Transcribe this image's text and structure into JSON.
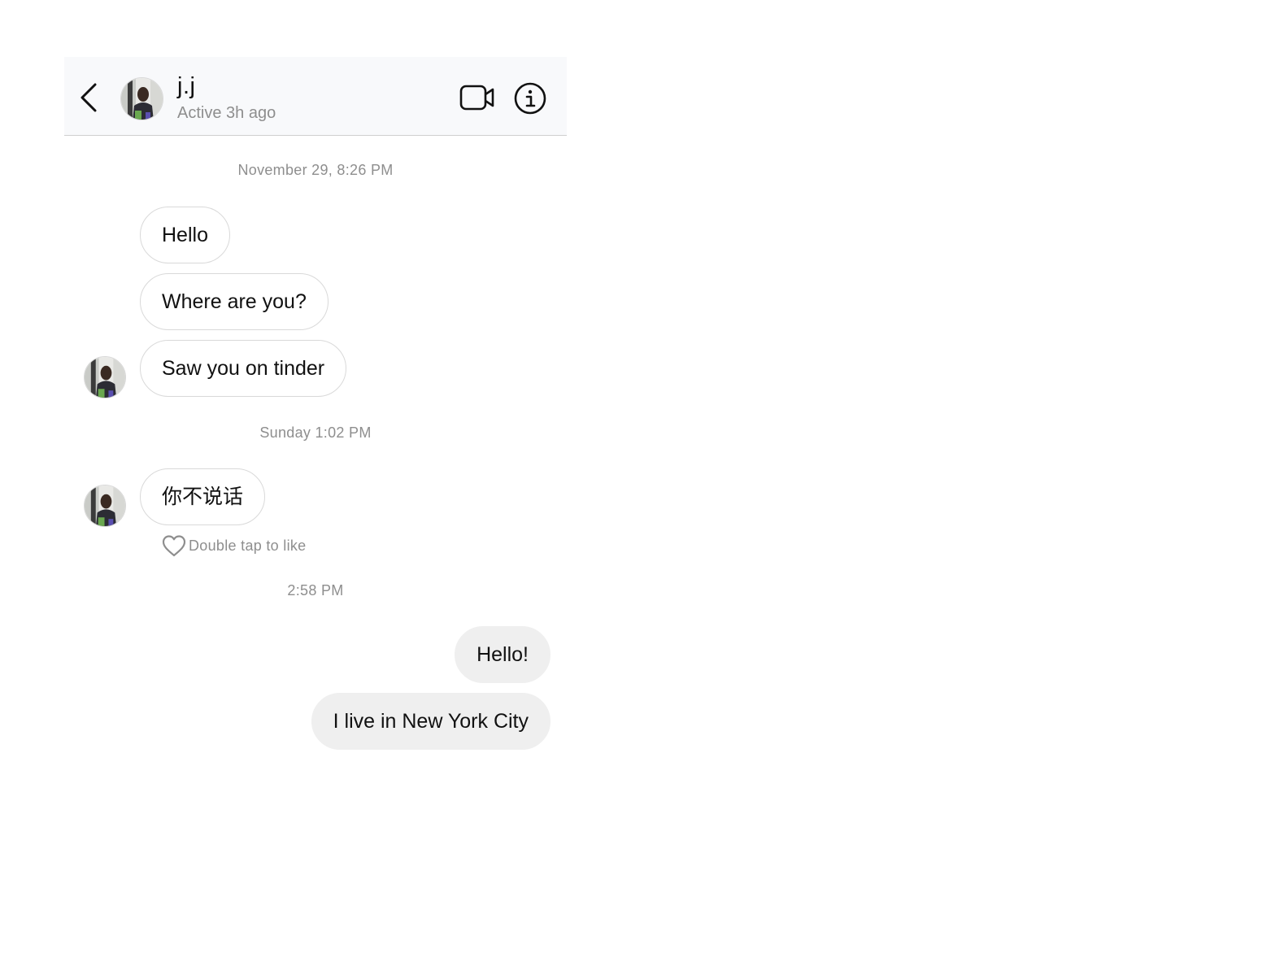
{
  "header": {
    "back_icon": "chevron-left-icon",
    "avatar_alt": "",
    "name": "j.j",
    "status": "Active 3h ago",
    "video_icon": "video-camera-icon",
    "info_icon": "info-icon"
  },
  "timestamps": [
    "November 29, 8:26 PM",
    "Sunday 1:02 PM",
    "2:58 PM"
  ],
  "messages": [
    {
      "side": "incoming",
      "text": "Hello"
    },
    {
      "side": "incoming",
      "text": "Where are you?"
    },
    {
      "side": "incoming",
      "text": "Saw you on tinder"
    },
    {
      "side": "incoming",
      "text": "你不说话"
    },
    {
      "side": "outgoing",
      "text": "Hello!"
    },
    {
      "side": "outgoing",
      "text": "I live in New York City"
    }
  ],
  "like_hint": {
    "icon": "heart-icon",
    "text": "Double tap to like"
  },
  "colors": {
    "header_bg": "#f8f9fb",
    "incoming_bubble_border": "#d9d9d9",
    "outgoing_bubble_bg": "#efefef",
    "muted_text": "#8e8e8e"
  }
}
